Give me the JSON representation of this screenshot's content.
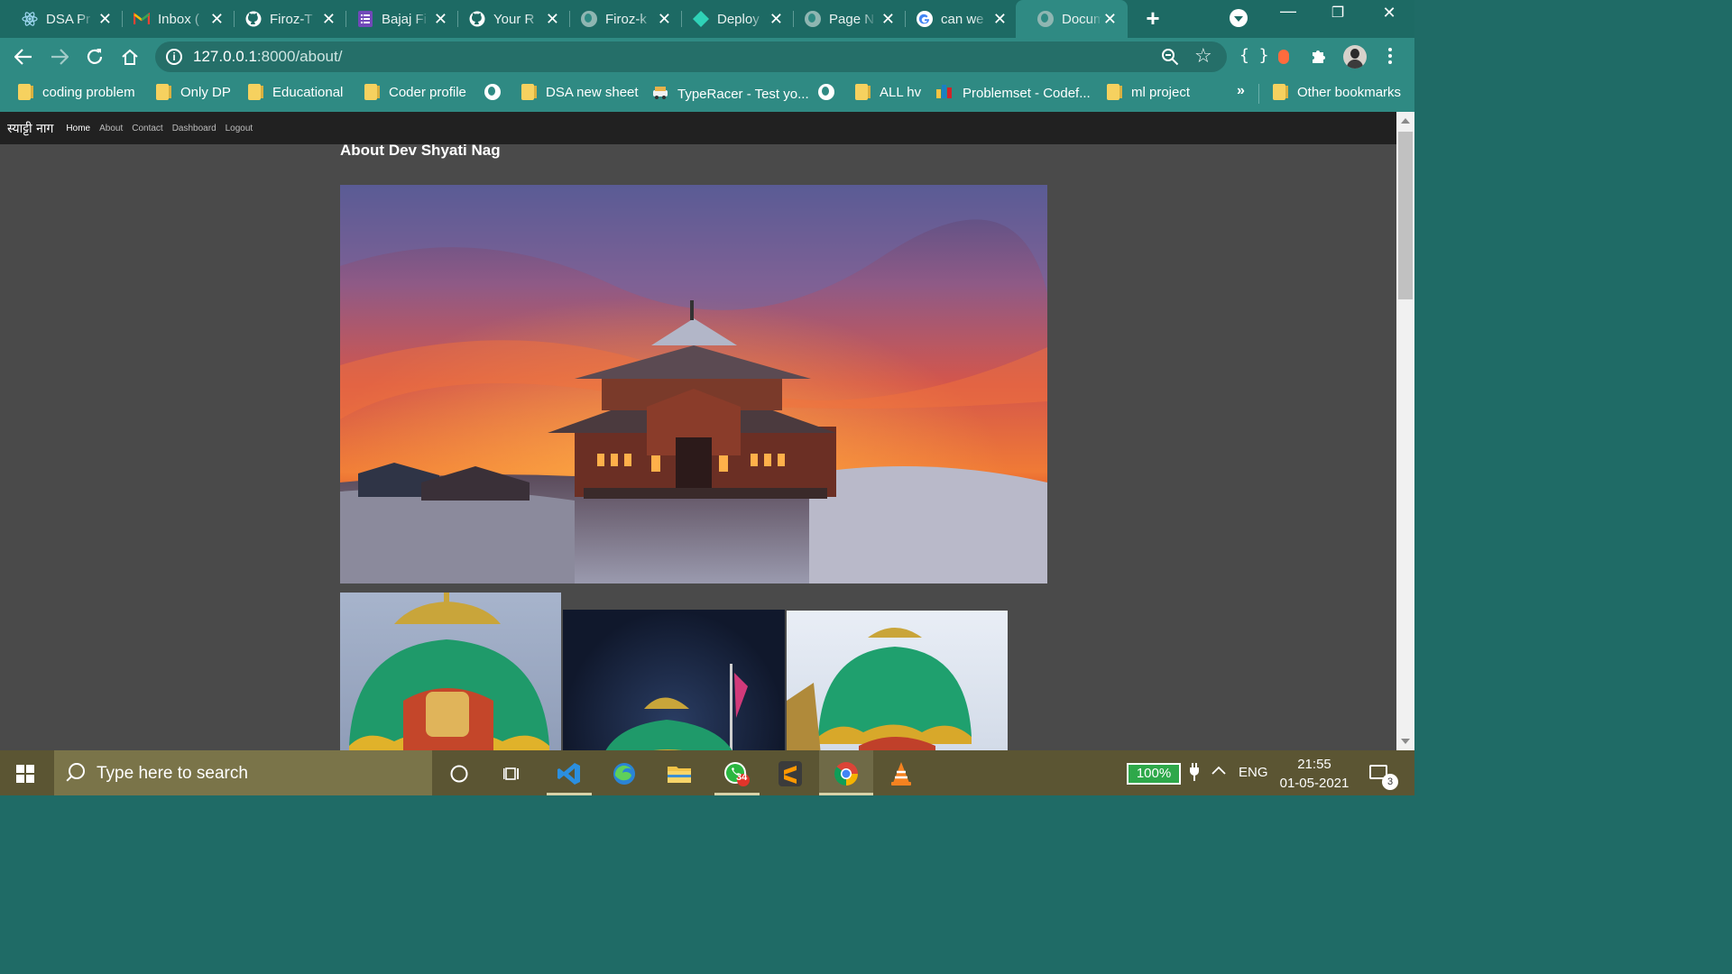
{
  "browser": {
    "tabs": [
      {
        "title": "DSA Pr",
        "icon": "react-icon",
        "active": false
      },
      {
        "title": "Inbox (",
        "icon": "gmail-icon",
        "active": false
      },
      {
        "title": "Firoz-T",
        "icon": "github-icon",
        "active": false
      },
      {
        "title": "Bajaj Fi",
        "icon": "forms-icon",
        "active": false
      },
      {
        "title": "Your R",
        "icon": "github-icon",
        "active": false
      },
      {
        "title": "Firoz-k",
        "icon": "globe-icon",
        "active": false
      },
      {
        "title": "Deploy",
        "icon": "deploy-icon",
        "active": false
      },
      {
        "title": "Page N",
        "icon": "globe-icon",
        "active": false
      },
      {
        "title": "can we",
        "icon": "google-icon",
        "active": false
      },
      {
        "title": "Docum",
        "icon": "globe-icon",
        "active": true
      }
    ],
    "url": {
      "host": "127.0.0.1",
      "path": ":8000/about/"
    },
    "bookmarks": [
      {
        "label": "coding problem",
        "icon": "folder-icon"
      },
      {
        "label": "Only DP",
        "icon": "folder-icon"
      },
      {
        "label": "Educational",
        "icon": "folder-icon"
      },
      {
        "label": "Coder profile",
        "icon": "folder-icon"
      },
      {
        "label": "",
        "icon": "globe-icon"
      },
      {
        "label": "DSA new sheet",
        "icon": "folder-icon"
      },
      {
        "label": "TypeRacer - Test yo...",
        "icon": "typeracer-icon"
      },
      {
        "label": "",
        "icon": "globe-icon"
      },
      {
        "label": "ALL hv",
        "icon": "folder-icon"
      },
      {
        "label": "Problemset - Codef...",
        "icon": "codeforces-icon"
      },
      {
        "label": "ml project",
        "icon": "folder-icon"
      }
    ],
    "overflow": "»",
    "other_bookmarks": "Other bookmarks",
    "theme_color": "#2f8a83"
  },
  "site": {
    "brand": "स्याट्टी नाग",
    "nav": [
      "Home",
      "About",
      "Contact",
      "Dashboard",
      "Logout"
    ],
    "heading": "About Dev Shyati Nag"
  },
  "taskbar": {
    "search_placeholder": "Type here to search",
    "whatsapp_badge": "34",
    "battery": "100%",
    "language": "ENG",
    "time": "21:55",
    "date": "01-05-2021",
    "notifications": "3"
  }
}
